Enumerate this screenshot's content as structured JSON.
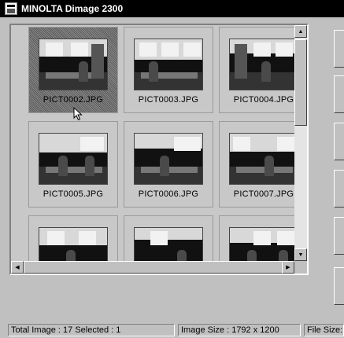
{
  "window": {
    "title": "MINOLTA Dimage 2300",
    "app_icon": "scanner-app-icon"
  },
  "thumbnails": [
    {
      "label": "PICT0002.JPG",
      "selected": true
    },
    {
      "label": "PICT0003.JPG",
      "selected": false
    },
    {
      "label": "PICT0004.JPG",
      "selected": false
    },
    {
      "label": "PICT0005.JPG",
      "selected": false
    },
    {
      "label": "PICT0006.JPG",
      "selected": false
    },
    {
      "label": "PICT0007.JPG",
      "selected": false
    },
    {
      "label": "",
      "selected": false
    },
    {
      "label": "",
      "selected": false
    },
    {
      "label": "",
      "selected": false
    }
  ],
  "scrollbars": {
    "up_arrow": "▲",
    "down_arrow": "▼",
    "left_arrow": "◀",
    "right_arrow": "▶"
  },
  "status": {
    "total_and_selected": "Total Image : 17   Selected : 1",
    "image_size": "Image Size : 1792 x 1200",
    "file_size": "File Size:"
  },
  "colors": {
    "titlebar": "#000000",
    "face": "#c0c0c0",
    "selected_hatch": "#6a6a6a"
  }
}
